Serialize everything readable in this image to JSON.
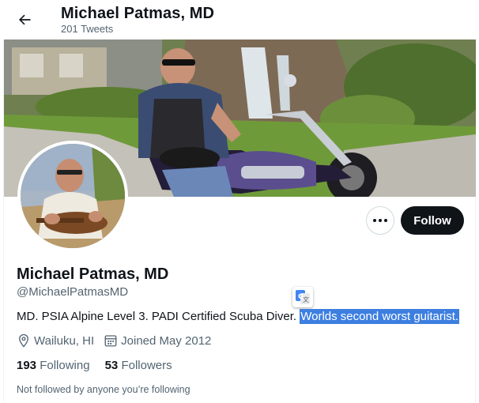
{
  "header": {
    "title": "Michael Patmas, MD",
    "subtitle": "201 Tweets"
  },
  "icons": {
    "back": "arrow-left-icon",
    "more": "more-horizontal-icon",
    "translate": "google-translate-icon",
    "location": "location-pin-icon",
    "calendar": "calendar-icon"
  },
  "profile": {
    "name": "Michael Patmas, MD",
    "handle": "@MichaelPatmasMD",
    "bio_plain": "MD. PSIA Alpine Level 3. PADI Certified Scuba Diver. ",
    "bio_highlighted": "Worlds second worst guitarist.",
    "location": "Wailuku, HI",
    "joined": "Joined May 2012",
    "following_count": "193",
    "following_label": "Following",
    "followers_count": "53",
    "followers_label": "Followers",
    "not_followed_note": "Not followed by anyone you’re following"
  },
  "actions": {
    "follow_label": "Follow"
  },
  "colors": {
    "text_primary": "#0f1419",
    "text_secondary": "#536471",
    "follow_button_bg": "#0f1419",
    "selection_highlight": "#3d7fe0"
  }
}
